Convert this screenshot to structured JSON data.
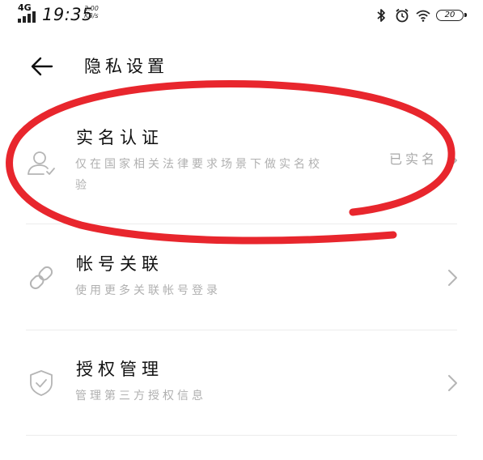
{
  "status_bar": {
    "network": "4G",
    "time": "19:35",
    "speed_value": "2.00",
    "speed_unit": "KB/s",
    "battery": "20",
    "icons": [
      "bluetooth-icon",
      "alarm-clock-icon",
      "wifi-icon",
      "battery-icon"
    ]
  },
  "header": {
    "back_icon": "arrow-left-icon",
    "title": "隐私设置"
  },
  "items": [
    {
      "title": "实名认证",
      "description": "仅在国家相关法律要求场景下做实名校验",
      "status": "已实名",
      "icon": "user-verify-icon"
    },
    {
      "title": "帐号关联",
      "description": "使用更多关联帐号登录",
      "status": "",
      "icon": "link-icon"
    },
    {
      "title": "授权管理",
      "description": "管理第三方授权信息",
      "status": "",
      "icon": "shield-check-icon"
    }
  ],
  "colors": {
    "title_text": "#111111",
    "secondary_text": "#b0b0b0",
    "icon_gray": "#b5b5b5",
    "divider": "#ececec",
    "annotation_red": "#e8262d"
  }
}
